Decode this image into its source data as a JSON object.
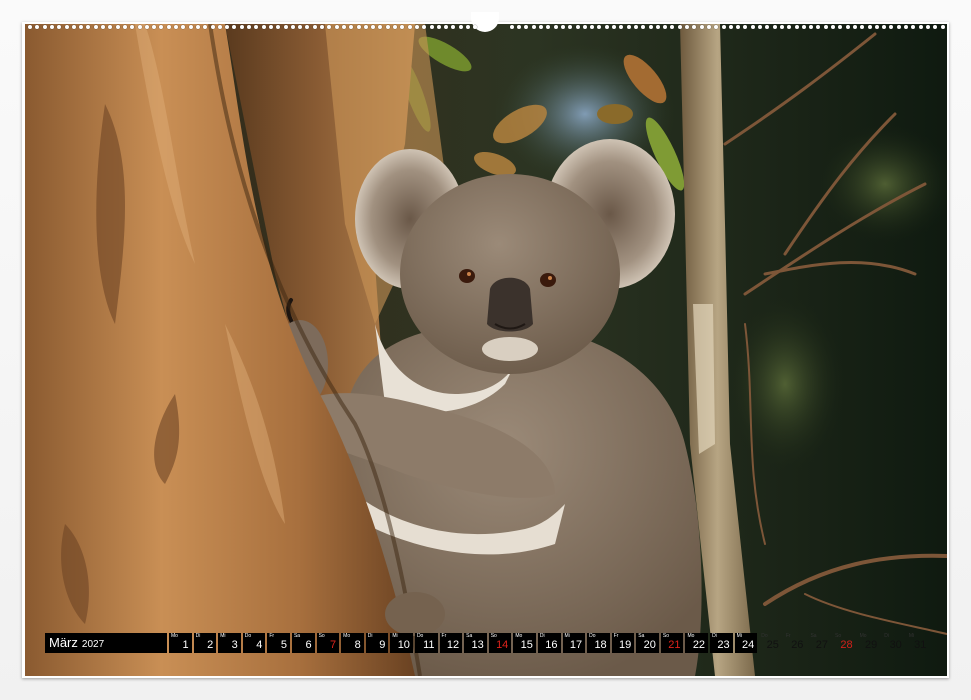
{
  "calendar": {
    "month": "März",
    "year": "2027",
    "days": [
      {
        "wd": "Mo",
        "num": "1",
        "sunday": false
      },
      {
        "wd": "Di",
        "num": "2",
        "sunday": false
      },
      {
        "wd": "Mi",
        "num": "3",
        "sunday": false
      },
      {
        "wd": "Do",
        "num": "4",
        "sunday": false
      },
      {
        "wd": "Fr",
        "num": "5",
        "sunday": false
      },
      {
        "wd": "Sa",
        "num": "6",
        "sunday": false
      },
      {
        "wd": "So",
        "num": "7",
        "sunday": true
      },
      {
        "wd": "Mo",
        "num": "8",
        "sunday": false
      },
      {
        "wd": "Di",
        "num": "9",
        "sunday": false
      },
      {
        "wd": "Mi",
        "num": "10",
        "sunday": false
      },
      {
        "wd": "Do",
        "num": "11",
        "sunday": false
      },
      {
        "wd": "Fr",
        "num": "12",
        "sunday": false
      },
      {
        "wd": "Sa",
        "num": "13",
        "sunday": false
      },
      {
        "wd": "So",
        "num": "14",
        "sunday": true
      },
      {
        "wd": "Mo",
        "num": "15",
        "sunday": false
      },
      {
        "wd": "Di",
        "num": "16",
        "sunday": false
      },
      {
        "wd": "Mi",
        "num": "17",
        "sunday": false
      },
      {
        "wd": "Do",
        "num": "18",
        "sunday": false
      },
      {
        "wd": "Fr",
        "num": "19",
        "sunday": false
      },
      {
        "wd": "Sa",
        "num": "20",
        "sunday": false
      },
      {
        "wd": "So",
        "num": "21",
        "sunday": true
      },
      {
        "wd": "Mo",
        "num": "22",
        "sunday": false
      },
      {
        "wd": "Di",
        "num": "23",
        "sunday": false
      },
      {
        "wd": "Mi",
        "num": "24",
        "sunday": false
      },
      {
        "wd": "Do",
        "num": "25",
        "sunday": false
      },
      {
        "wd": "Fr",
        "num": "26",
        "sunday": false
      },
      {
        "wd": "Sa",
        "num": "27",
        "sunday": false
      },
      {
        "wd": "So",
        "num": "28",
        "sunday": true
      },
      {
        "wd": "Mo",
        "num": "29",
        "sunday": false
      },
      {
        "wd": "Di",
        "num": "30",
        "sunday": false
      },
      {
        "wd": "Mi",
        "num": "31",
        "sunday": false
      }
    ],
    "colors": {
      "cell_background": "#000000",
      "day_text": "#ffffff",
      "sunday_text": "#e0231b"
    }
  },
  "photo": {
    "subject": "koala-in-eucalyptus-tree"
  }
}
